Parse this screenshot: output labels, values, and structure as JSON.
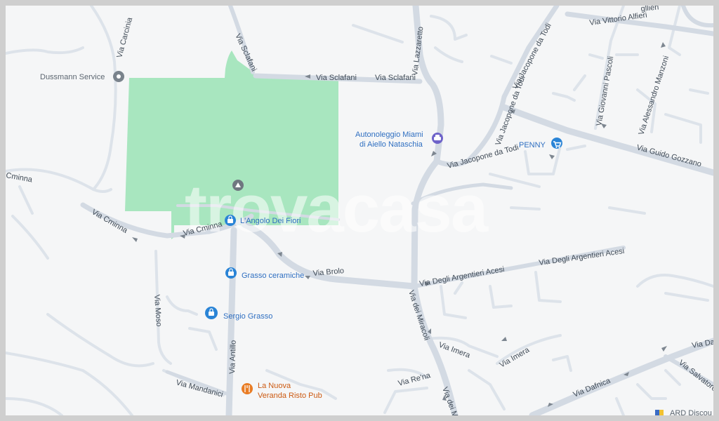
{
  "map": {
    "watermark": "trovacasa",
    "colors": {
      "background": "#f5f6f7",
      "park": "#a8e6bf",
      "road": "#d3dae3",
      "poi_blue": "#2f6fc1",
      "poi_orange": "#cc5a12"
    },
    "streets": {
      "carcinia": "Via Carcinia",
      "sclafani_v": "Via Sclafani",
      "sclafani_h1": "Via Sclafani",
      "sclafani_h2": "Via Sclafani",
      "lazzaretto": "Via Lazzaretto",
      "jacopone_1": "Via Jacopone da Todi",
      "jacopone_2": "Via Jacopone da Todi",
      "jacopone_3": "Via Jacopone da Todi",
      "alfieri": "Via Vittorio Alfieri",
      "alfieri_top": "gllieri",
      "pascoli": "Via Giovanni Pascoli",
      "manzoni": "Via Alessandro Manzoni",
      "gozzano": "Via Guido Gozzano",
      "cminna_left": "Cminna",
      "cminna_1": "Via Cminna",
      "cminna_2": "Via Cminna",
      "brolo": "Via Brolo",
      "argentieri_1": "Via Degli Argentieri Acesi",
      "argentieri_2": "Via Degli Argentieri Acesi",
      "miracoli": "Via dei Miracoli",
      "miracoli_2": "Via dei M",
      "moso": "Via Moso",
      "antillo": "Via Antillo",
      "mandanici": "Via Mandanici",
      "imera_1": "Via Imera",
      "imera_2": "Via Imera",
      "rena": "Via Re'na",
      "dafnica": "Via Dafnica",
      "salvatore": "Via Salvatore",
      "da": "Via Da"
    },
    "pois": {
      "dussmann": {
        "label": "Dussmann Service",
        "icon": "location-pin-icon"
      },
      "autonoleggio_1": {
        "label": "Autonoleggio Miami",
        "icon": "car-icon"
      },
      "autonoleggio_2": {
        "label": "di Aiello Nataschia"
      },
      "penny": {
        "label": "PENNY",
        "icon": "shopping-cart-icon"
      },
      "angolo": {
        "label": "L'Angolo Dei Fiori",
        "icon": "shopping-bag-icon"
      },
      "grasso_ceramiche": {
        "label": "Grasso ceramiche",
        "icon": "shopping-bag-icon"
      },
      "sergio": {
        "label": "Sergio Grasso",
        "icon": "shopping-bag-icon"
      },
      "nuova_1": {
        "label": "La Nuova",
        "icon": "restaurant-icon"
      },
      "nuova_2": {
        "label": "Veranda Risto Pub"
      },
      "ard": {
        "label": "ARD Discou"
      },
      "park_marker": {
        "icon": "landmark-icon"
      }
    }
  }
}
